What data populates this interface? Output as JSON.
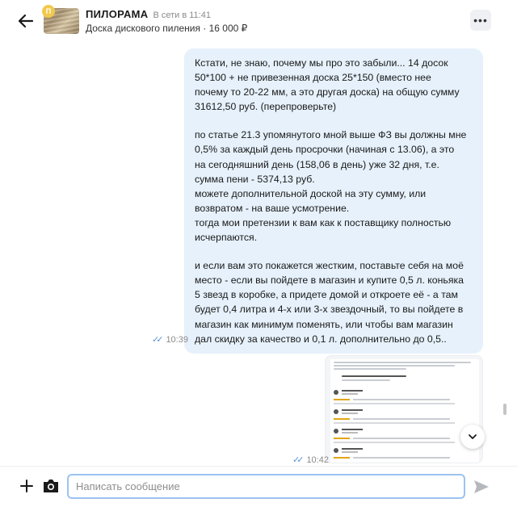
{
  "header": {
    "back_icon": "arrow-left-icon",
    "avatar_badge": "П",
    "title": "ПИЛОРАМА",
    "status": "В сети в 11:41",
    "listing": "Доска дискового пиления · 16 000 ₽",
    "menu_icon": "more-horizontal-icon",
    "menu_label": "•••"
  },
  "messages": [
    {
      "type": "text",
      "outgoing": true,
      "paragraphs": [
        "Кстати, не знаю, почему мы про это забыли... 14 досок\n50*100 + не привезенная доска 25*150 (вместо нее\nпочему то 20-22 мм, а это другая доска) на общую сумму\n31612,50 руб. (перепроверьте)",
        "по статье 21.3 упомянутого мной выше ФЗ вы должны мне\n0,5% за каждый день просрочки (начиная с 13.06), а это\nна сегодняшний день (158,06 в день) уже 32 дня, т.е.\nсумма пени - 5374,13 руб.\nможете дополнительной доской на эту сумму, или\nвозвратом - на ваше усмотрение.\nтогда мои претензии к вам как к поставщику полностью\nисчерпаются.",
        "и если вам это покажется жестким, поставьте себя на моё\nместо - если вы пойдете в магазин и купите 0,5 л. коньяка\n5 звезд в коробке, а придете домой и откроете её - а там\nбудет 0,4 литра и 4-х или 3-х звездочный, то вы пойдете в\nмагазин как минимум поменять, или чтобы вам магазин\nдал скидку за качество и 0,1 л. дополнительно до 0,5.."
      ],
      "time": "10:39",
      "read_icon": "double-check-icon"
    },
    {
      "type": "image",
      "outgoing": true,
      "time": "10:42",
      "read_icon": "double-check-icon"
    }
  ],
  "composer": {
    "add_icon": "plus-icon",
    "camera_icon": "camera-icon",
    "placeholder": "Написать сообщение",
    "value": "",
    "send_icon": "send-icon"
  },
  "scroll_down_icon": "chevron-down-icon",
  "colors": {
    "bubble": "#e6f1fb",
    "read_check": "#5b93d6",
    "input_border": "#9cc3f0",
    "badge": "#f2c94c"
  }
}
